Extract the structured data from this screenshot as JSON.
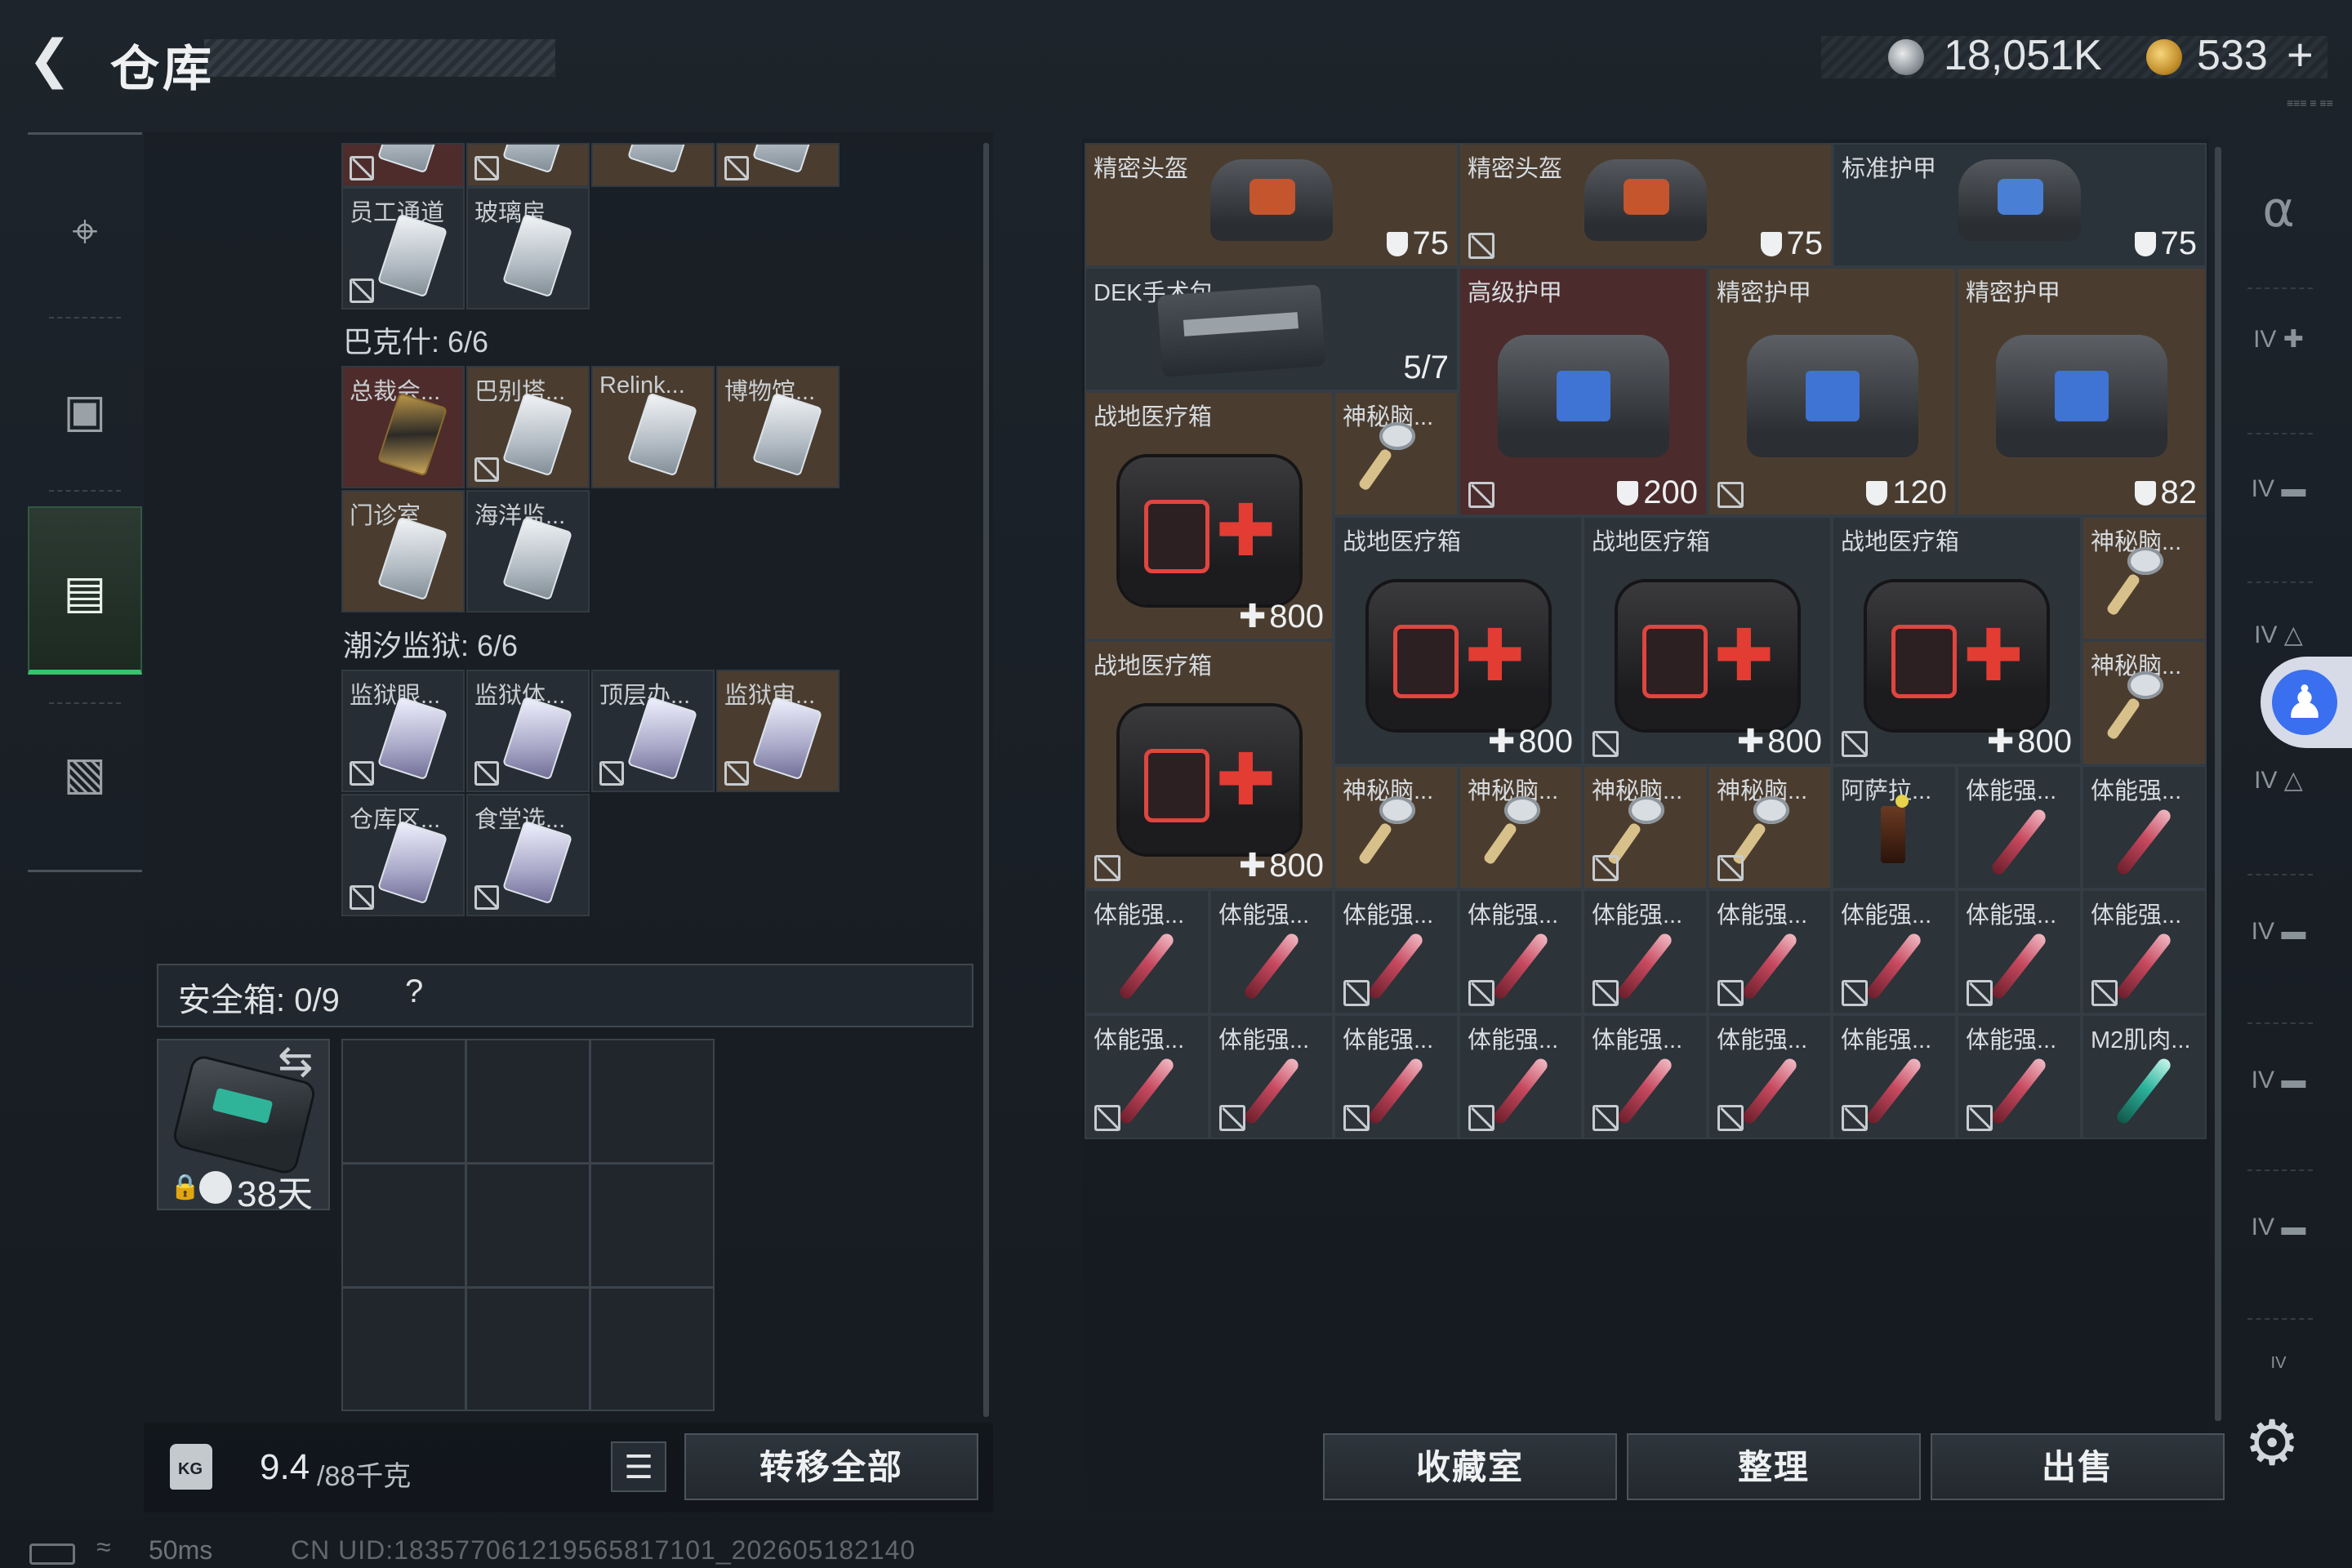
{
  "header": {
    "title": "仓库",
    "money": "18,051K",
    "cash": "533",
    "cash_plus": "+",
    "cash_sub": "≡≡≡ ≡ ≡≡"
  },
  "left_nav": [
    "gun-icon",
    "backpack-icon",
    "storage-icon",
    "briefcase-icon"
  ],
  "keycards": {
    "top_row": [
      "",
      "",
      "",
      ""
    ],
    "row1": [
      {
        "name": "员工通道",
        "style": "plain"
      },
      {
        "name": "玻璃房",
        "style": "plain"
      }
    ],
    "section1": {
      "label": "巴克什: 6/6"
    },
    "row2": [
      {
        "name": "总裁会...",
        "style": "gold"
      },
      {
        "name": "巴别塔...",
        "style": "plain"
      },
      {
        "name": "Relink...",
        "style": "plain"
      },
      {
        "name": "博物馆...",
        "style": "plain"
      }
    ],
    "row3": [
      {
        "name": "门诊室",
        "style": "plain"
      },
      {
        "name": "海洋监...",
        "style": "plain"
      }
    ],
    "section2": {
      "label": "潮汐监狱: 6/6"
    },
    "row4": [
      {
        "name": "监狱眼...",
        "style": "vio"
      },
      {
        "name": "监狱体...",
        "style": "vio"
      },
      {
        "name": "顶层办...",
        "style": "vio"
      },
      {
        "name": "监狱审...",
        "style": "vio"
      }
    ],
    "row5": [
      {
        "name": "仓库区...",
        "style": "vio"
      },
      {
        "name": "食堂选...",
        "style": "vio"
      }
    ]
  },
  "safe_box": {
    "label": "安全箱: 0/9",
    "help": "?",
    "days": "38天"
  },
  "bottom_left": {
    "bag_badge": "KG",
    "weight": "9.4",
    "weight_max": "/88千克",
    "transfer_all": "转移全部"
  },
  "items": [
    {
      "name": "精密头盔",
      "value": "75"
    },
    {
      "name": "精密头盔",
      "value": "75"
    },
    {
      "name": "标准护甲",
      "value": "75"
    },
    {
      "name": "DEK手术包",
      "value": "5/7"
    },
    {
      "name": "高级护甲",
      "value": "200"
    },
    {
      "name": "精密护甲",
      "value": "120"
    },
    {
      "name": "精密护甲",
      "value": "82"
    },
    {
      "name": "战地医疗箱",
      "value": "800"
    },
    {
      "name": "神秘脑...",
      "value": ""
    },
    {
      "name": "战地医疗箱",
      "value": "800"
    },
    {
      "name": "战地医疗箱",
      "value": "800"
    },
    {
      "name": "战地医疗箱",
      "value": "800"
    },
    {
      "name": "神秘脑...",
      "value": ""
    },
    {
      "name": "战地医疗箱",
      "value": "800"
    },
    {
      "name": "神秘脑...",
      "value": ""
    },
    {
      "name": "神秘脑...",
      "value": ""
    },
    {
      "name": "神秘脑...",
      "value": ""
    },
    {
      "name": "神秘脑...",
      "value": ""
    },
    {
      "name": "神秘脑...",
      "value": ""
    },
    {
      "name": "阿萨拉...",
      "value": ""
    },
    {
      "name": "体能强...",
      "value": ""
    },
    {
      "name": "体能强...",
      "value": ""
    },
    {
      "name": "体能强...",
      "value": ""
    },
    {
      "name": "体能强...",
      "value": ""
    },
    {
      "name": "体能强...",
      "value": ""
    },
    {
      "name": "体能强...",
      "value": ""
    },
    {
      "name": "体能强...",
      "value": ""
    },
    {
      "name": "体能强...",
      "value": ""
    },
    {
      "name": "体能强...",
      "value": ""
    },
    {
      "name": "体能强...",
      "value": ""
    },
    {
      "name": "体能强...",
      "value": ""
    },
    {
      "name": "体能强...",
      "value": ""
    },
    {
      "name": "体能强...",
      "value": ""
    },
    {
      "name": "体能强...",
      "value": ""
    },
    {
      "name": "体能强...",
      "value": ""
    },
    {
      "name": "体能强...",
      "value": ""
    },
    {
      "name": "体能强...",
      "value": ""
    },
    {
      "name": "体能强...",
      "value": ""
    },
    {
      "name": "体能强...",
      "value": ""
    },
    {
      "name": "M2肌肉...",
      "value": ""
    }
  ],
  "bottom_right": {
    "collection": "收藏室",
    "sort": "整理",
    "sell": "出售"
  },
  "right_nav": [
    "IV",
    "IV",
    "IV",
    "IV",
    "IV",
    "IV",
    "IV",
    "IV"
  ],
  "status": {
    "ping": "50ms",
    "uid": "CN UID:1835770612195658171​01_202605182140"
  }
}
